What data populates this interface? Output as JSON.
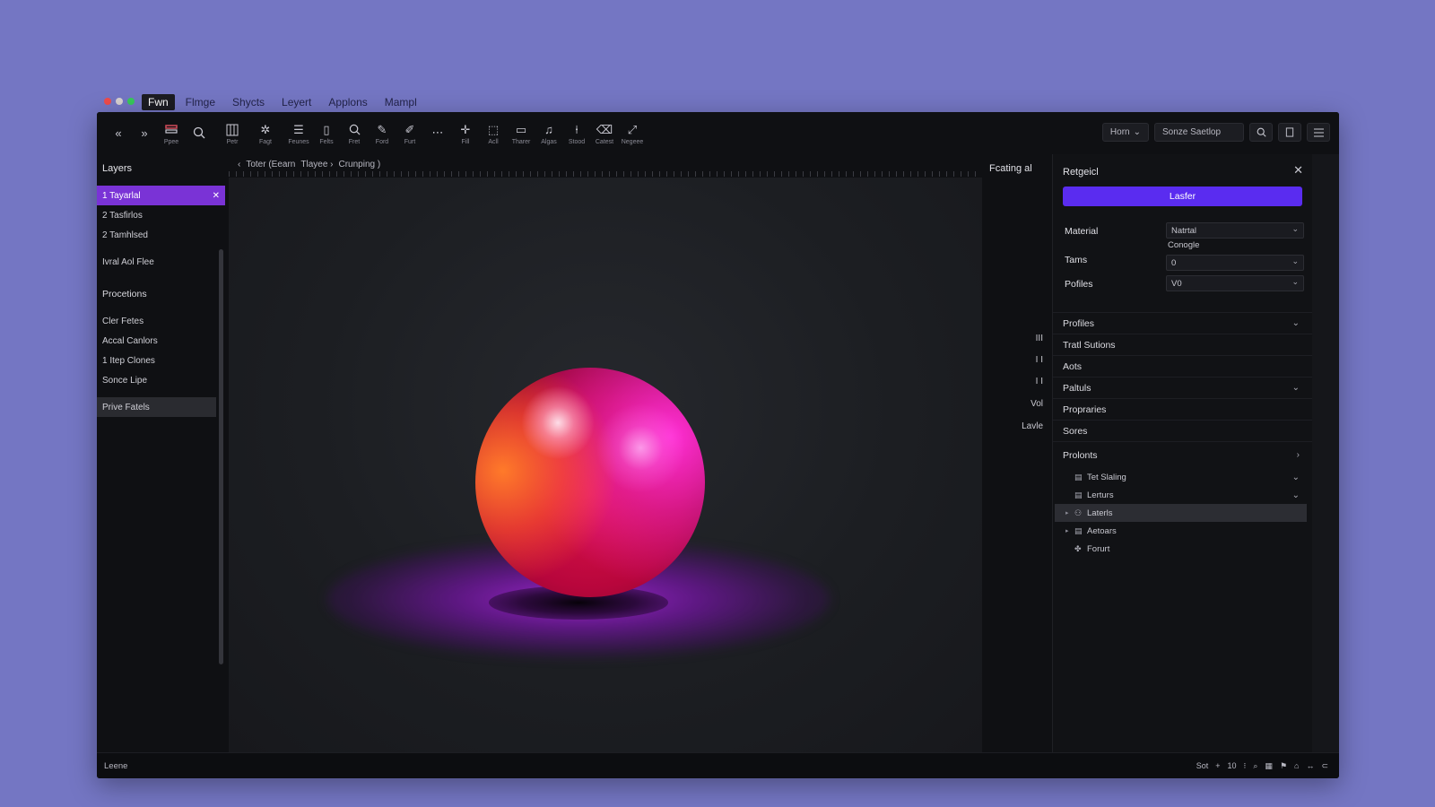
{
  "menubar": {
    "items": [
      "Fwn",
      "Flmge",
      "Shycts",
      "Leyert",
      "Applons",
      "Mampl"
    ]
  },
  "toolbar": {
    "tools": [
      {
        "icon": "chevron-left-double-icon",
        "label": ""
      },
      {
        "icon": "chevron-right-double-icon",
        "label": ""
      },
      {
        "icon": "layers-tool-icon",
        "label": "Ppee"
      },
      {
        "icon": "search-icon",
        "label": ""
      },
      {
        "icon": "grid-icon",
        "label": "Petr"
      },
      {
        "icon": "sparkle-icon",
        "label": "Fagt"
      },
      {
        "icon": "list-icon",
        "label": "Feunes"
      },
      {
        "icon": "rectangle-icon",
        "label": "Felts"
      },
      {
        "icon": "magnify-icon",
        "label": "Fret"
      },
      {
        "icon": "pen-icon",
        "label": "Ford"
      },
      {
        "icon": "brush-icon",
        "label": "Furt"
      },
      {
        "icon": "more-icon",
        "label": ""
      },
      {
        "icon": "move-icon",
        "label": "Fill"
      },
      {
        "icon": "select-icon",
        "label": "Acll"
      },
      {
        "icon": "camera-icon",
        "label": "Tharer"
      },
      {
        "icon": "music-icon",
        "label": "Algas"
      },
      {
        "icon": "knife-icon",
        "label": "Stood"
      },
      {
        "icon": "eraser-icon",
        "label": "Catest"
      },
      {
        "icon": "line-icon",
        "label": "Negeee"
      }
    ],
    "right": {
      "mode_select": "Horn",
      "search_placeholder": "Sonze Saetlop"
    }
  },
  "left_panel": {
    "title": "Layers",
    "layers": [
      "1 Tayarlal",
      "2 Tasfirlos",
      "2 Tamhlsed"
    ],
    "extra": "Ivral Aol Flee",
    "section": "Procetions",
    "items": [
      "Cler Fetes",
      "Accal Canlors",
      "1 Itep Clones",
      "Sonce Lipe"
    ],
    "last": "Prive Fatels"
  },
  "canvas": {
    "breadcrumb": [
      "‹",
      "Toter (Eearn",
      "Tlayee ›",
      "Crunping )"
    ]
  },
  "mid_strip": {
    "title": "Fcating al",
    "items": [
      "III",
      "I I",
      "I I",
      "Vol",
      "Lavle"
    ]
  },
  "right_panel": {
    "title": "Retgeicl",
    "primary_button": "Lasfer",
    "properties": {
      "material_label": "Material",
      "material_value": "Natrtal",
      "extra_value": "Conogle",
      "tams_label": "Tams",
      "tams_value": "0",
      "profiles_label": "Pofiles",
      "profiles_value": "V0"
    },
    "rows": [
      "Profiles",
      "Tratl Sutions",
      "Aots",
      "Paltuls",
      "Propraries",
      "Sores",
      "Prolonts"
    ],
    "tree": [
      {
        "label": "Tet Slaling",
        "icon": "doc-icon"
      },
      {
        "label": "Lerturs",
        "icon": "doc-icon"
      },
      {
        "label": "Laterls",
        "icon": "user-icon"
      },
      {
        "label": "Aetoars",
        "icon": "doc-icon"
      },
      {
        "label": "Forurt",
        "icon": "pin-icon"
      }
    ]
  },
  "statusbar": {
    "left": "Leene",
    "right": [
      "Sot",
      "+",
      "10",
      "⁝",
      "⌕",
      "▦",
      "⚑",
      "⌂",
      "↔",
      "⊂"
    ]
  },
  "colors": {
    "background": "#7476c3",
    "accent": "#7a33d6",
    "primary_button": "#5a2cf0",
    "window": "#15161a"
  }
}
